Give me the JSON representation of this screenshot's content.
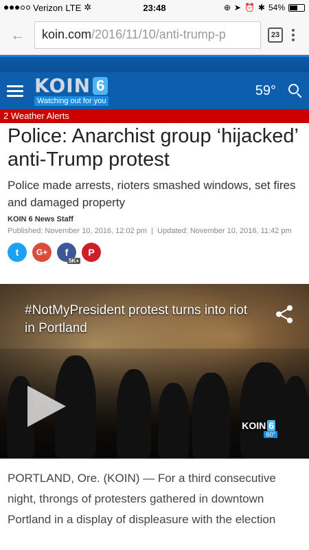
{
  "status_bar": {
    "carrier": "Verizon",
    "network": "LTE",
    "time": "23:48",
    "battery": "54%",
    "battery_level": 0.54
  },
  "browser": {
    "url_host": "koin.com",
    "url_path": "/2016/11/10/anti-trump-p",
    "tab_count": "23"
  },
  "site_header": {
    "logo_text": "KOIN",
    "logo_number": "6",
    "tagline": "Watching out for you",
    "temperature": "59°"
  },
  "alert": {
    "text": "2 Weather Alerts"
  },
  "article": {
    "headline": "Police: Anarchist group ‘hijacked’ anti-Trump protest",
    "subheadline": "Police made arrests, rioters smashed windows, set fires and damaged property",
    "author": "KOIN 6 News Staff",
    "published": "Published: November 10, 2016, 12:02 pm",
    "separator": "|",
    "updated": "Updated: November 10, 2016, 11:42 pm",
    "share": {
      "twitter": "t",
      "google": "G+",
      "facebook": "f",
      "pinterest": "P",
      "facebook_count": "5K+"
    },
    "body": "PORTLAND, Ore. (KOIN) — For a third consecutive night, throngs of protesters gathered in downtown Portland in a display of displeasure with the election"
  },
  "video": {
    "title": "#NotMyPresident protest turns into riot in Portland",
    "watermark_logo": "KOIN",
    "watermark_number": "6",
    "watermark_temp": "60°"
  },
  "colors": {
    "header_blue": "#0d5fae",
    "alert_red": "#cc0000"
  }
}
